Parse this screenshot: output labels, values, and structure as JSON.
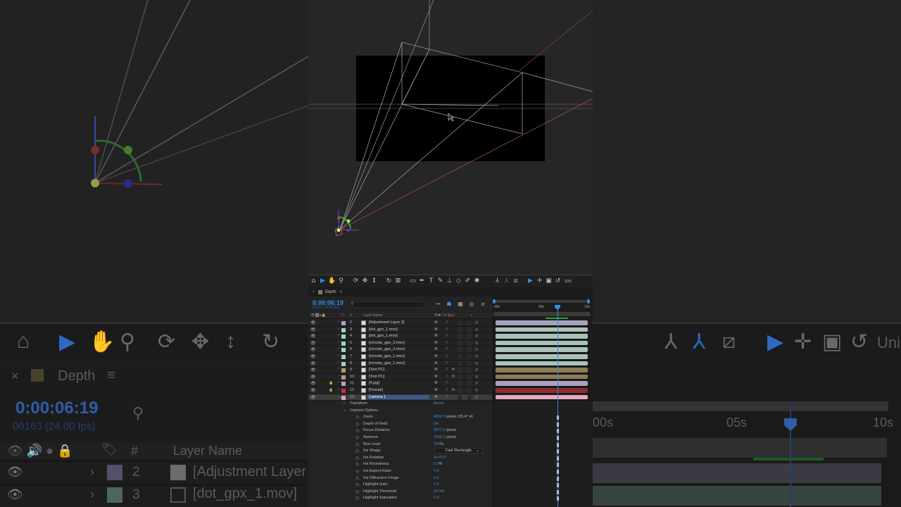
{
  "comp": {
    "tab_name": "Depth"
  },
  "timecode": "0:00:06:19",
  "frames_fps": "00163 (24.00 fps)",
  "search_placeholder": "",
  "columns": {
    "layer_name": "Layer Name",
    "hash": "#"
  },
  "toolbar": {
    "tools": [
      "home-icon",
      "selection-tool-icon",
      "hand-tool-icon",
      "zoom-tool-icon",
      "orbit-camera-icon",
      "pan-camera-icon",
      "dolly-camera-icon",
      "rotation-tool-icon",
      "pan-behind-icon",
      "rectangle-tool-icon",
      "pen-tool-icon",
      "type-tool-icon",
      "brush-tool-icon",
      "clone-stamp-icon",
      "eraser-icon",
      "roto-brush-icon",
      "puppet-pin-icon",
      "axis-local-icon",
      "axis-world-icon",
      "axis-view-icon",
      "snap-select-icon",
      "snap-move-icon",
      "snap-box-icon",
      "snap-undo-icon"
    ],
    "trailing_label": "Uni"
  },
  "layers": [
    {
      "num": "2",
      "name": "[Adjustment Layer 2]",
      "label_color": "#a9a3c7",
      "bar_color": "#a7a3bf",
      "lock": false
    },
    {
      "num": "3",
      "name": "[dot_gpx_1.mov]",
      "label_color": "#9fd1c1",
      "bar_color": "#a9c2b8",
      "lock": false
    },
    {
      "num": "4",
      "name": "[dot_gpx_1.mov]",
      "label_color": "#9fd1c1",
      "bar_color": "#a9c2b8",
      "lock": false
    },
    {
      "num": "5",
      "name": "[circular_gpx_3.mov]",
      "label_color": "#9fd1c1",
      "bar_color": "#a9c2b8",
      "lock": false
    },
    {
      "num": "6",
      "name": "[circular_gpx_2.mov]",
      "label_color": "#9fd1c1",
      "bar_color": "#a9c2b8",
      "lock": false
    },
    {
      "num": "7",
      "name": "[circular_gpx_1.mov]",
      "label_color": "#9fd1c1",
      "bar_color": "#a9c2b8",
      "lock": false
    },
    {
      "num": "8",
      "name": "[circular_gpx_1.mov]",
      "label_color": "#9fd1c1",
      "bar_color": "#a9c2b8",
      "lock": false
    },
    {
      "num": "9",
      "name": "[Text PC]",
      "label_color": "#b59e6a",
      "bar_color": "#8c7c58",
      "lock": false
    },
    {
      "num": "10",
      "name": "[Text PC]",
      "label_color": "#b59e6a",
      "bar_color": "#8c7c58",
      "lock": false
    },
    {
      "num": "11",
      "name": "[4.jpg]",
      "label_color": "#a9a3c7",
      "bar_color": "#a7a3bf",
      "lock": true
    },
    {
      "num": "12",
      "name": "[Fractal]",
      "label_color": "#c0303a",
      "bar_color": "#8a2b36",
      "lock": true
    },
    {
      "num": "13",
      "name": "Camera 1",
      "label_color": "#e3a3b8",
      "bar_color": "#e6a8bd",
      "lock": false
    }
  ],
  "properties": [
    {
      "name": "Transform",
      "value": "",
      "unit": "",
      "type": "group",
      "reset": "Reset"
    },
    {
      "name": "Camera Options",
      "value": "",
      "unit": "",
      "type": "group"
    },
    {
      "name": "Zoom",
      "value": "4266.0",
      "unit": " pixels (25.4° H)",
      "type": "prop"
    },
    {
      "name": "Depth of Field",
      "value": "On",
      "unit": "",
      "type": "prop"
    },
    {
      "name": "Focus Distance",
      "value": "2977.0",
      "unit": " pixels",
      "type": "prop"
    },
    {
      "name": "Aperture",
      "value": "2500.0",
      "unit": " pixels",
      "type": "prop"
    },
    {
      "name": "Blur Level",
      "value": "100",
      "unit": "%",
      "type": "prop"
    },
    {
      "name": "Iris Shape",
      "value": "Fast Rectangle",
      "unit": "",
      "type": "dropdown"
    },
    {
      "name": "Iris Rotation",
      "value": "0x+0.0°",
      "unit": "",
      "type": "prop"
    },
    {
      "name": "Iris Roundness",
      "value": "0.0",
      "unit": "%",
      "type": "prop"
    },
    {
      "name": "Iris Aspect Ratio",
      "value": "1.0",
      "unit": "",
      "type": "prop"
    },
    {
      "name": "Iris Diffraction Fringe",
      "value": "0.0",
      "unit": "",
      "type": "prop"
    },
    {
      "name": "Highlight Gain",
      "value": "0.0",
      "unit": "",
      "type": "prop"
    },
    {
      "name": "Highlight Threshold",
      "value": "32768",
      "unit": "",
      "type": "prop"
    },
    {
      "name": "Highlight Saturation",
      "value": "0.0",
      "unit": "",
      "type": "prop"
    }
  ],
  "timeline": {
    "ruler": [
      "00s",
      "05s",
      "10s"
    ],
    "current_time_fraction": 0.66
  },
  "background": {
    "tab_name": "Depth",
    "timecode": "0:00:06:19",
    "frames_fps": "00163 (24.00 fps)",
    "col_layer_name": "Layer Name",
    "col_hash": "#",
    "row1_num": "2",
    "row1_name": "[Adjustment Layer",
    "row2_num": "3",
    "row2_name": "[dot_gpx_1.mov]",
    "ruler": [
      "00s",
      "05s",
      "10s"
    ],
    "tool_label": "Uni"
  },
  "colors": {
    "accent": "#3a8dde",
    "panel": "#232323",
    "viewport": "#262626"
  }
}
